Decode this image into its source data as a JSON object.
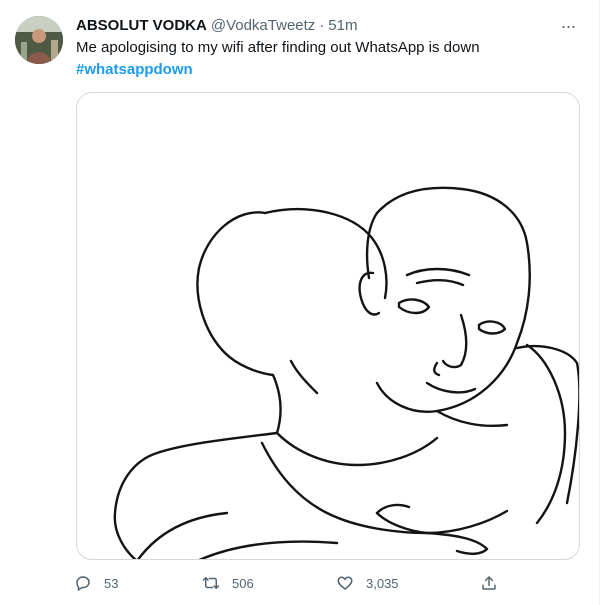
{
  "tweet": {
    "author_name": "ABSOLUT VODKA",
    "handle": "@VodkaTweetz",
    "separator": "·",
    "time": "51m",
    "text": "Me apologising to my wifi after finding out WhatsApp is down",
    "hashtag": "#whatsappdown",
    "more_label": "···",
    "media_icon": "hug-meme-image"
  },
  "actions": {
    "replies": "53",
    "retweets": "506",
    "likes": "3,035"
  },
  "colors": {
    "link": "#1d9bf0",
    "secondary_text": "#536471",
    "primary_text": "#0f1419",
    "border": "#cfd9de"
  }
}
